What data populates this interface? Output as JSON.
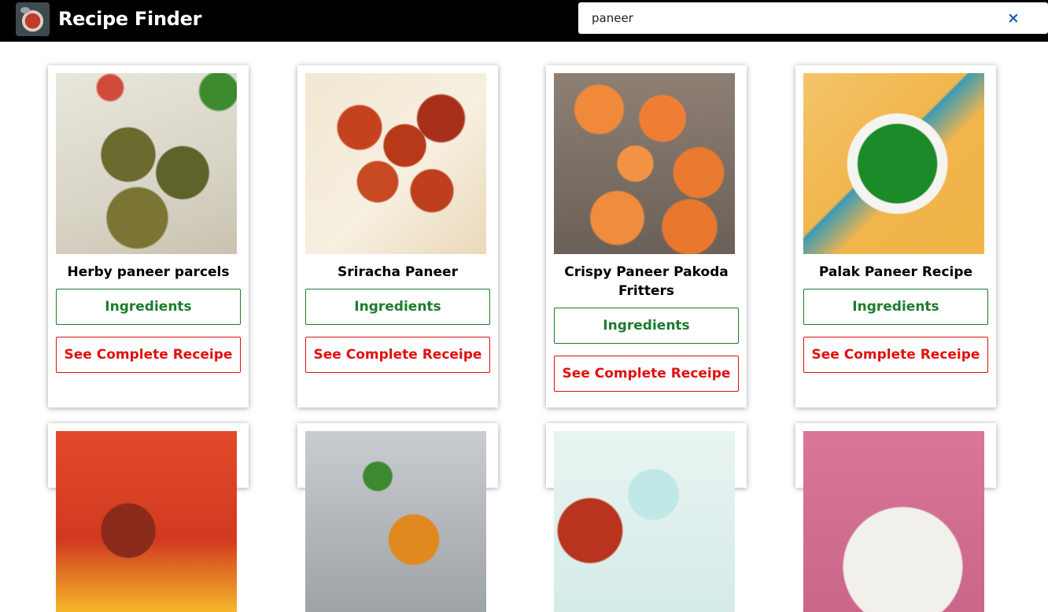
{
  "header": {
    "title": "Recipe Finder",
    "logo_icon": "food-plate-icon"
  },
  "search": {
    "value": "paneer",
    "clear_label": "×"
  },
  "colors": {
    "header_bg": "#000000",
    "ingredients_accent": "#1e7b2e",
    "recipe_accent": "#e01010",
    "clear_icon": "#1f5bb4"
  },
  "recipes": [
    {
      "name": "Herby paneer parcels",
      "ingredients_label": "Ingredients",
      "recipe_label": "See Complete Receipe"
    },
    {
      "name": "Sriracha Paneer",
      "ingredients_label": "Ingredients",
      "recipe_label": "See Complete Receipe"
    },
    {
      "name": "Crispy Paneer Pakoda Fritters",
      "ingredients_label": "Ingredients",
      "recipe_label": "See Complete Receipe"
    },
    {
      "name": "Palak Paneer Recipe",
      "ingredients_label": "Ingredients",
      "recipe_label": "See Complete Receipe"
    }
  ]
}
